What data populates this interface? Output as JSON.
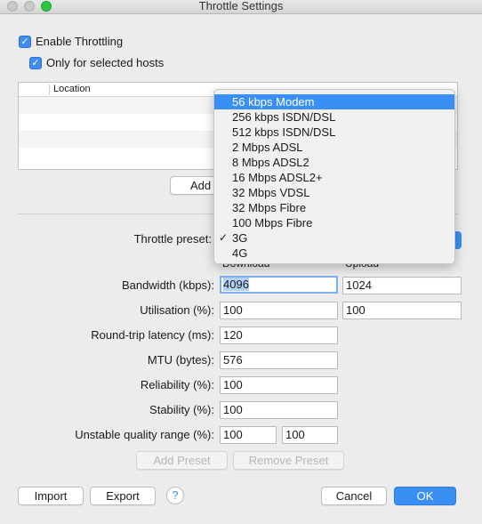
{
  "window": {
    "title": "Throttle Settings"
  },
  "options": {
    "enable_throttling": "Enable Throttling",
    "only_selected_hosts": "Only for selected hosts"
  },
  "hosts_table": {
    "column_location": "Location"
  },
  "hosts_buttons": {
    "add": "Add"
  },
  "preset": {
    "label": "Throttle preset:",
    "selected": "3G",
    "menu": [
      "56 kbps Modem",
      "256 kbps ISDN/DSL",
      "512 kbps ISDN/DSL",
      "2 Mbps ADSL",
      "8 Mbps ADSL2",
      "16 Mbps ADSL2+",
      "32 Mbps VDSL",
      "32 Mbps Fibre",
      "100 Mbps Fibre",
      "3G",
      "4G"
    ],
    "highlighted": "56 kbps Modem",
    "checkmark": "✓"
  },
  "columns": {
    "download": "Download",
    "upload": "Upload"
  },
  "fields": {
    "bandwidth": {
      "label": "Bandwidth (kbps):",
      "download": "4096",
      "upload": "1024"
    },
    "utilisation": {
      "label": "Utilisation (%):",
      "download": "100",
      "upload": "100"
    },
    "latency": {
      "label": "Round-trip latency (ms):",
      "value": "120"
    },
    "mtu": {
      "label": "MTU (bytes):",
      "value": "576"
    },
    "reliability": {
      "label": "Reliability (%):",
      "value": "100"
    },
    "stability": {
      "label": "Stability (%):",
      "value": "100"
    },
    "unstable_range": {
      "label": "Unstable quality range (%):",
      "min": "100",
      "max": "100"
    }
  },
  "preset_buttons": {
    "add": "Add Preset",
    "remove": "Remove Preset"
  },
  "footer": {
    "import": "Import",
    "export": "Export",
    "help": "?",
    "cancel": "Cancel",
    "ok": "OK"
  }
}
